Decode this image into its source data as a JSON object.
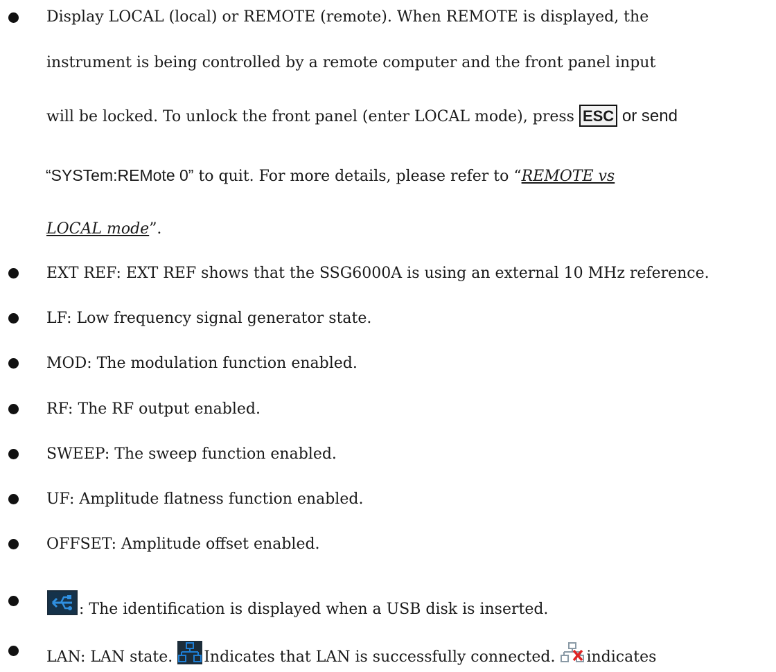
{
  "bullets": {
    "display": {
      "line1": "Display LOCAL (local) or REMOTE (remote). When REMOTE is displayed, the",
      "line2": "instrument is being controlled by a remote computer and the front panel input",
      "line3_pre": "will be locked. To unlock the front panel (enter LOCAL mode), press ",
      "esc_key": "ESC",
      "line3_post": " or send",
      "line4_cmd": "“SYSTem:REMote 0”",
      "line4_mid": " to quit. For more details, please refer to “",
      "link_part1": "REMOTE vs",
      "link_part2": "LOCAL mode",
      "link_close": "”."
    },
    "ext_ref": "EXT REF: EXT REF shows that the SSG6000A is using an external 10 MHz reference.",
    "lf": "LF: Low frequency signal generator state.",
    "mod": "MOD: The modulation function enabled.",
    "rf": "RF: The RF output enabled.",
    "sweep": "SWEEP: The sweep function enabled.",
    "uf": "UF: Amplitude flatness function enabled.",
    "offset": "OFFSET: Amplitude offset enabled.",
    "usb_text": ": The identification is displayed when a USB disk is inserted.",
    "lan_pre": "LAN: LAN state. ",
    "lan_connected": "Indicates that LAN is successfully connected. ",
    "lan_disconnected": "indicates"
  },
  "icons": {
    "usb": "usb-icon",
    "lan_connected": "lan-connected-icon",
    "lan_disconnected": "lan-disconnected-icon",
    "bullet": "bullet-dot"
  },
  "colors": {
    "text": "#1a1a1a",
    "icon_blue": "#1e7fd6",
    "icon_bg": "#1c2d3a",
    "usb_blue": "#2f8fe0",
    "disconnected_red": "#e02424"
  }
}
